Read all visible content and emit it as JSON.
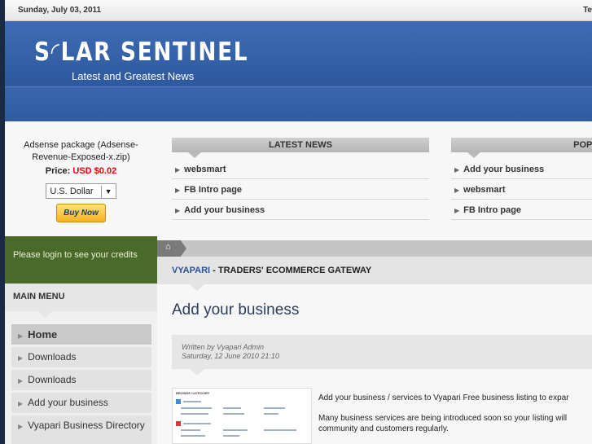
{
  "topbar": {
    "date": "Sunday, July 03, 2011",
    "right_text": "Te"
  },
  "header": {
    "logo": "S◜LAR SENTINEL",
    "tagline": "Latest and Greatest News"
  },
  "sidebar": {
    "adsense": {
      "package": "Adsense package (Adsense-Revenue-Exposed-x.zip)",
      "price_label": "Price:",
      "price_value": "USD $0.02",
      "currency": "U.S. Dollar",
      "buy": "Buy Now"
    },
    "login_text": "Please login to see your credits",
    "main_menu_title": "MAIN MENU",
    "menu_items": [
      "Home",
      "Downloads",
      "Downloads",
      "Add your business",
      "Vyapari Business Directory"
    ]
  },
  "latest_news": {
    "title": "LATEST NEWS",
    "items": [
      "websmart",
      "FB Intro page",
      "Add your business"
    ]
  },
  "popular": {
    "title": "POPULA",
    "items": [
      "Add your business",
      "websmart",
      "FB Intro page"
    ]
  },
  "breadcrumb": {
    "home_icon": "home-icon"
  },
  "section": {
    "brand": "VYAPARI",
    "rest": " - TRADERS' ECOMMERCE GATEWAY"
  },
  "article": {
    "title": "Add your business",
    "written_by": "Written by Vyapari Admin",
    "date": "Saturday, 12 June 2010 21:10",
    "thumb_heading": "BROWSE CATEGORY",
    "para1": "Add your business / services to Vyapari Free business listing to expar",
    "para2": "Many business services are being introduced soon so your listing will community and customers regularly."
  },
  "colors": {
    "header_blue": "#2f5aa0",
    "login_green": "#4a6a2a",
    "price_red": "#ee0000",
    "brand_blue": "#2a5196"
  }
}
